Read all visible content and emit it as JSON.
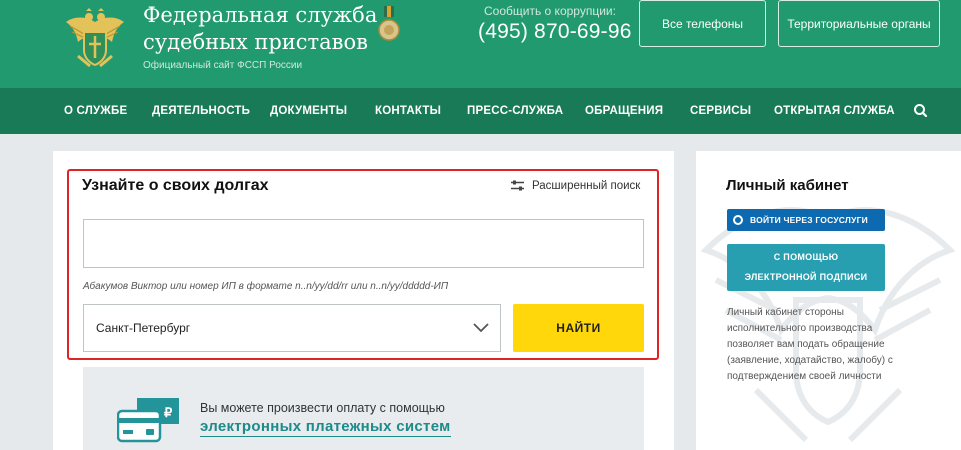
{
  "header": {
    "title_line1": "Федеральная служба",
    "title_line2": "судебных приставов",
    "subtitle": "Официальный сайт ФССП России",
    "corruption_label": "Сообщить о коррупции:",
    "corruption_phone": "(495) 870-69-96",
    "btn_phones": "Все телефоны",
    "btn_regions": "Территориальные органы"
  },
  "nav": {
    "items": [
      "О СЛУЖБЕ",
      "ДЕЯТЕЛЬНОСТЬ",
      "ДОКУМЕНТЫ",
      "КОНТАКТЫ",
      "ПРЕСС-СЛУЖБА",
      "ОБРАЩЕНИЯ",
      "СЕРВИСЫ",
      "ОТКРЫТАЯ СЛУЖБА"
    ],
    "search_icon": "search-icon"
  },
  "search": {
    "title": "Узнайте о своих долгах",
    "advanced_label": "Расширенный поиск",
    "input_value": "",
    "hint": "Абакумов Виктор или номер ИП в формате n..n/yy/dd/rr или n..n/yy/ddddd-ИП",
    "region_value": "Санкт-Петербург",
    "find_label": "НАЙТИ"
  },
  "payment": {
    "text": "Вы можете произвести оплату с помощью",
    "link": "электронных платежных систем",
    "icon": "card-ruble-icon"
  },
  "cabinet": {
    "title": "Личный кабинет",
    "gosuslugi_label": "ВОЙТИ ЧЕРЕЗ ГОСУСЛУГИ",
    "signature_line1": "С ПОМОЩЬЮ",
    "signature_line2": "ЭЛЕКТРОННОЙ ПОДПИСИ",
    "description": "Личный кабинет стороны исполнительного производства позволяет вам подать обращение (заявление, ходатайство, жалобу) с подтверждением своей личности"
  },
  "colors": {
    "header_bg": "#219a6f",
    "nav_bg": "#197a58",
    "find_button": "#ffd70a",
    "highlight_border": "#e02424",
    "gosuslugi_button": "#0d6ab1",
    "signature_button": "#289fb0",
    "link": "#1e8a8a"
  }
}
